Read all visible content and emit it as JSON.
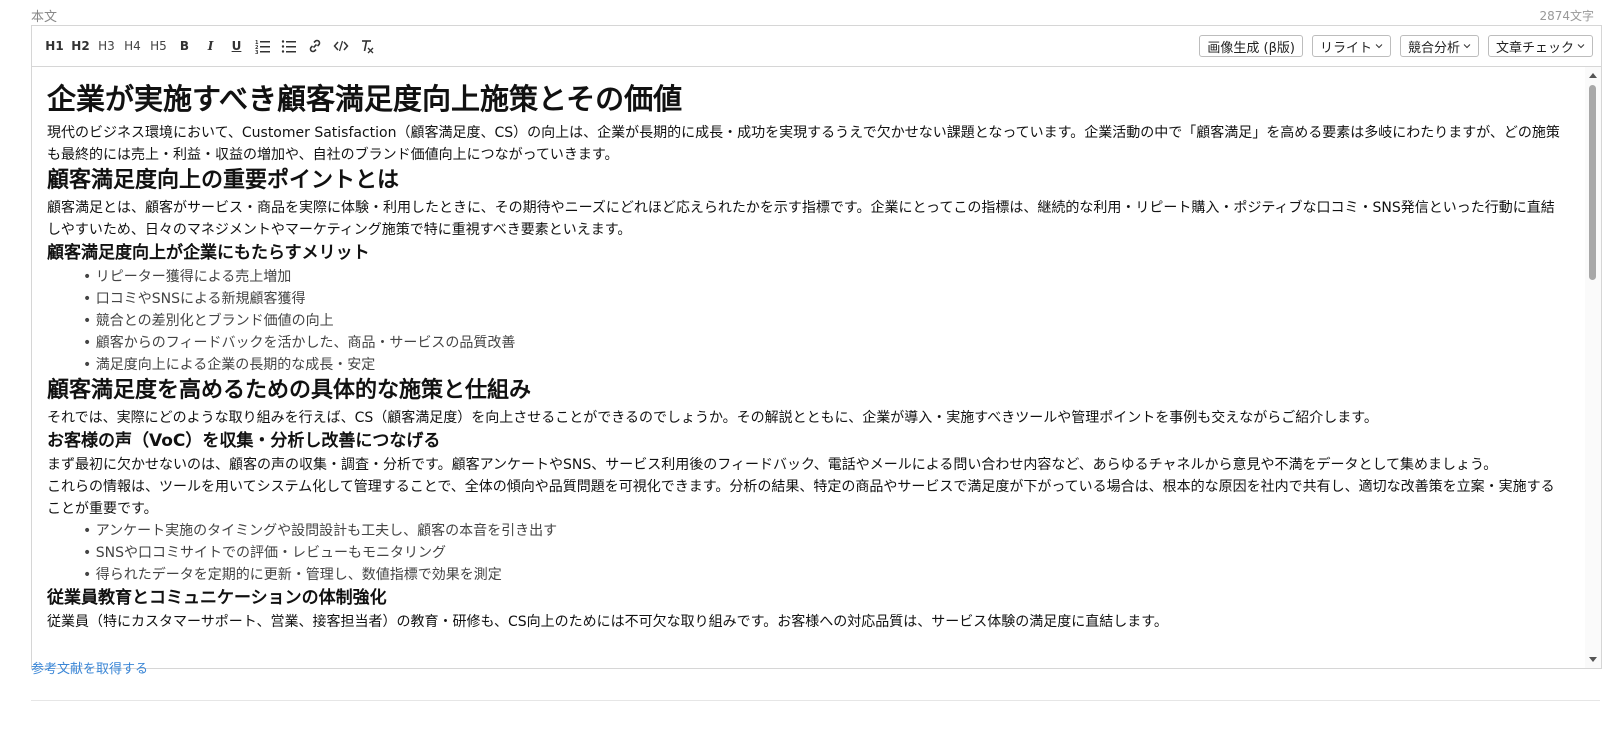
{
  "field": {
    "label": "本文",
    "char_count": "2874文字"
  },
  "toolbar": {
    "h1": "H1",
    "h2": "H2",
    "h3": "H3",
    "h4": "H4",
    "h5": "H5",
    "bold": "B",
    "italic": "I",
    "underline": "U",
    "buttons": {
      "image_gen": "画像生成 (β版)",
      "rewrite": "リライト",
      "competitor": "競合分析",
      "check": "文章チェック"
    }
  },
  "doc": {
    "title": "企業が実施すべき顧客満足度向上施策とその価値",
    "intro": "現代のビジネス環境において、Customer Satisfaction（顧客満足度、CS）の向上は、企業が長期的に成長・成功を実現するうえで欠かせない課題となっています。企業活動の中で「顧客満足」を高める要素は多岐にわたりますが、どの施策も最終的には売上・利益・収益の増加や、自社のブランド価値向上につながっていきます。",
    "s1_heading": "顧客満足度向上の重要ポイントとは",
    "s1_para": "顧客満足とは、顧客がサービス・商品を実際に体験・利用したときに、その期待やニーズにどれほど応えられたかを示す指標です。企業にとってこの指標は、継続的な利用・リピート購入・ポジティブな口コミ・SNS発信といった行動に直結しやすいため、日々のマネジメントやマーケティング施策で特に重視すべき要素といえます。",
    "s1_sub": "顧客満足度向上が企業にもたらすメリット",
    "s1_list": [
      "リピーター獲得による売上増加",
      "口コミやSNSによる新規顧客獲得",
      "競合との差別化とブランド価値の向上",
      "顧客からのフィードバックを活かした、商品・サービスの品質改善",
      "満足度向上による企業の長期的な成長・安定"
    ],
    "s2_heading": "顧客満足度を高めるための具体的な施策と仕組み",
    "s2_para": "それでは、実際にどのような取り組みを行えば、CS（顧客満足度）を向上させることができるのでしょうか。その解説とともに、企業が導入・実施すべきツールや管理ポイントを事例も交えながらご紹介します。",
    "s2_sub": "お客様の声（VoC）を収集・分析し改善につなげる",
    "s2_para2": "まず最初に欠かせないのは、顧客の声の収集・調査・分析です。顧客アンケートやSNS、サービス利用後のフィードバック、電話やメールによる問い合わせ内容など、あらゆるチャネルから意見や不満をデータとして集めましょう。",
    "s2_para3": "これらの情報は、ツールを用いてシステム化して管理することで、全体の傾向や品質問題を可視化できます。分析の結果、特定の商品やサービスで満足度が下がっている場合は、根本的な原因を社内で共有し、適切な改善策を立案・実施することが重要です。",
    "s2_list": [
      "アンケート実施のタイミングや設問設計も工夫し、顧客の本音を引き出す",
      "SNSや口コミサイトでの評価・レビューもモニタリング",
      "得られたデータを定期的に更新・管理し、数値指標で効果を測定"
    ],
    "s3_sub": "従業員教育とコミュニケーションの体制強化",
    "s3_para": "従業員（特にカスタマーサポート、営業、接客担当者）の教育・研修も、CS向上のためには不可欠な取り組みです。お客様への対応品質は、サービス体験の満足度に直結します。"
  },
  "footer": {
    "ref_link": "参考文献を取得する"
  }
}
